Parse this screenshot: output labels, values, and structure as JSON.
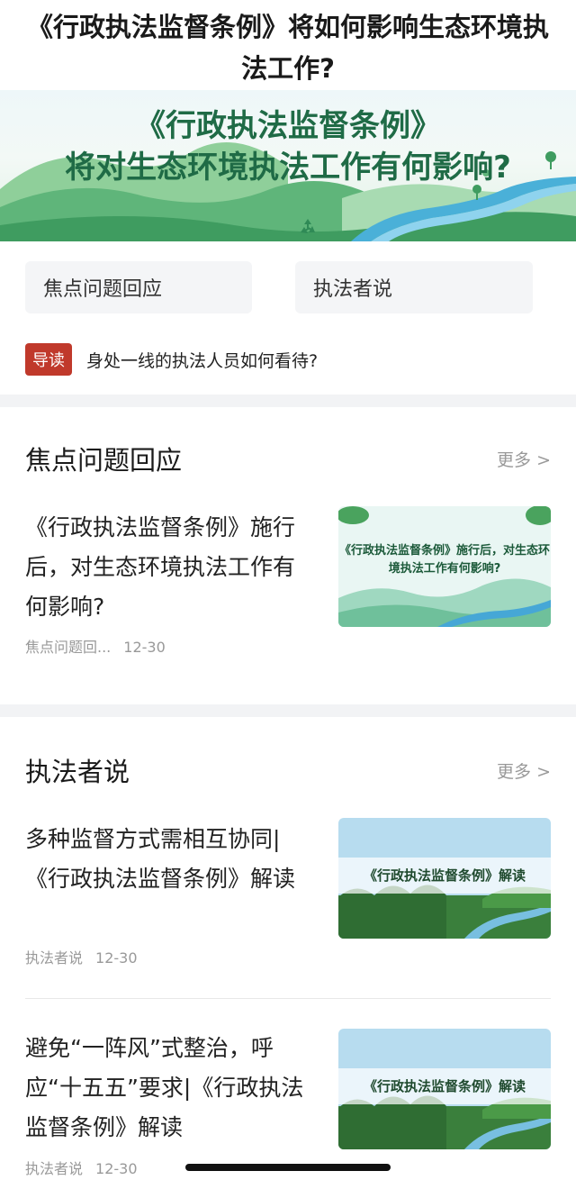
{
  "page": {
    "title": "《行政执法监督条例》将如何影响生态环境执法工作?"
  },
  "banner": {
    "line1": "《行政执法监督条例》",
    "line2": "将对生态环境执法工作有何影响?",
    "icon": "recycle-icon"
  },
  "tabs": [
    {
      "label": "焦点问题回应"
    },
    {
      "label": "执法者说"
    }
  ],
  "guide": {
    "badge": "导读",
    "text": "身处一线的执法人员如何看待?"
  },
  "sections": [
    {
      "title": "焦点问题回应",
      "more": "更多 >",
      "articles": [
        {
          "title": "《行政执法监督条例》施行后，对生态环境执法工作有何影响?",
          "source": "焦点问题回...",
          "date": "12-30",
          "thumb_label": "《行政执法监督条例》施行后，对生态环境执法工作有何影响?"
        }
      ]
    },
    {
      "title": "执法者说",
      "more": "更多 >",
      "articles": [
        {
          "title": "多种监督方式需相互协同|《行政执法监督条例》解读",
          "source": "执法者说",
          "date": "12-30",
          "thumb_label": "《行政执法监督条例》解读"
        },
        {
          "title": "避免“一阵风”式整治，呼应“十五五”要求|《行政执法监督条例》解读",
          "source": "执法者说",
          "date": "12-30",
          "thumb_label": "《行政执法监督条例》解读"
        }
      ]
    }
  ],
  "colors": {
    "badge": "#c0392b",
    "banner_text": "#1f6b46",
    "meta_text": "#999999"
  }
}
